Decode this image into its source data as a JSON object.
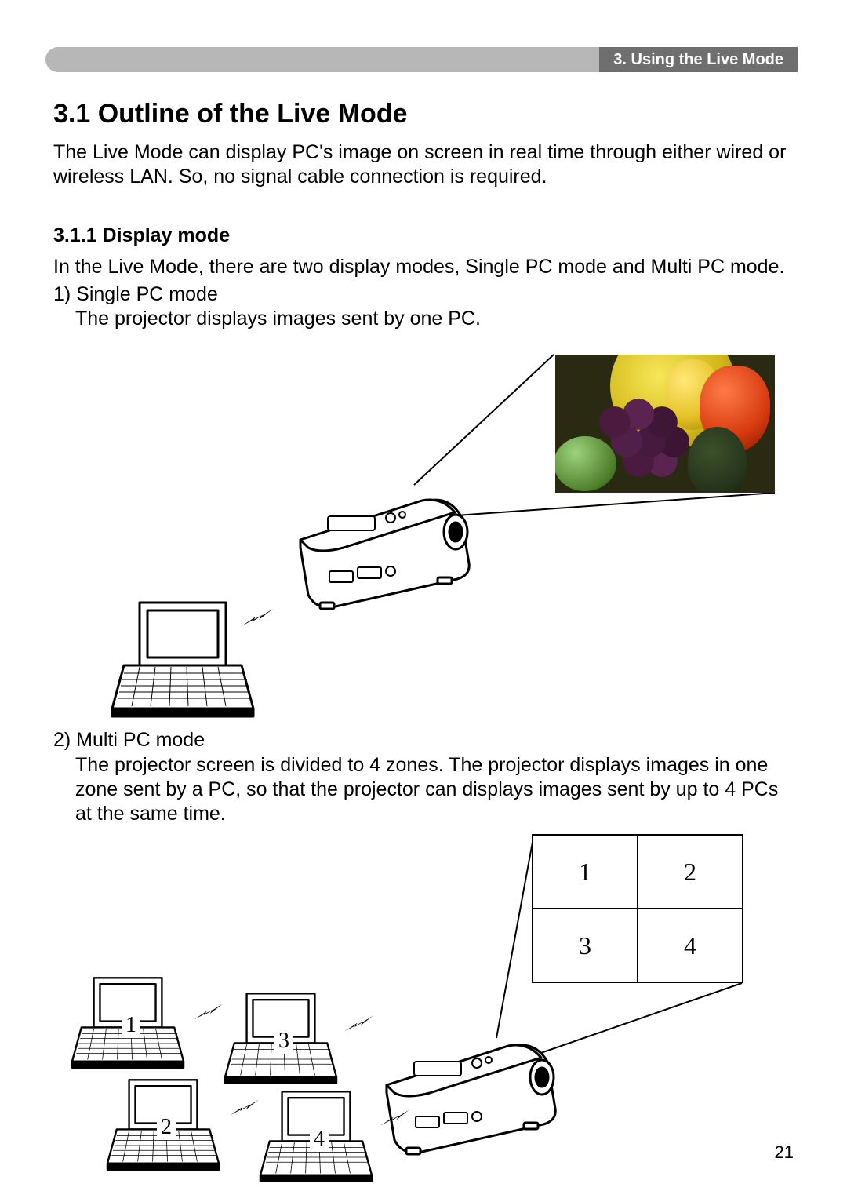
{
  "header": {
    "chapter_tab": "3. Using the Live Mode"
  },
  "section": {
    "heading": "3.1 Outline of the Live Mode",
    "intro": "The Live Mode can display PC's image on screen in real time through either wired or wireless LAN. So, no signal cable connection is required."
  },
  "subsection": {
    "heading": "3.1.1 Display mode",
    "intro": "In the Live Mode, there are two display modes, Single PC mode and Multi PC mode.",
    "item1_title": "1) Single PC mode",
    "item1_body": "The projector displays images sent by one PC.",
    "item2_title": "2) Multi PC mode",
    "item2_body": "The projector screen is divided to 4 zones. The projector displays images in one zone sent by a PC, so that the projector can displays images sent by up to 4 PCs at the same time."
  },
  "grid_labels": {
    "z1": "1",
    "z2": "2",
    "z3": "3",
    "z4": "4"
  },
  "laptop_labels": {
    "l1": "1",
    "l2": "2",
    "l3": "3",
    "l4": "4"
  },
  "page_number": "21"
}
